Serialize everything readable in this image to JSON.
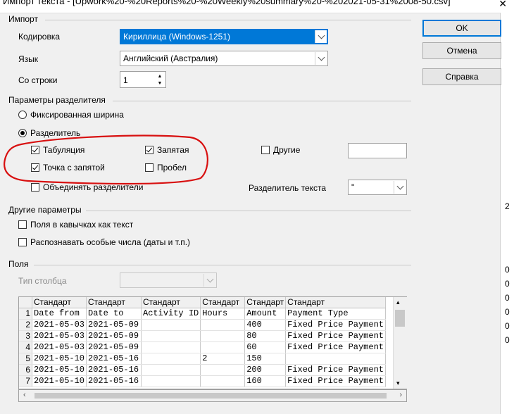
{
  "window": {
    "title": "Импорт текста - [Upwork%20-%20Reports%20-%20Weekly%20summary%20-%202021-05-31%2008-50.csv]"
  },
  "import": {
    "section": "Импорт",
    "encoding_label": "Кодировка",
    "encoding_value": "Кириллица (Windows-1251)",
    "language_label": "Язык",
    "language_value": "Английский (Австралия)",
    "from_row_label": "Со строки",
    "from_row_value": "1"
  },
  "buttons": {
    "ok": "OK",
    "cancel": "Отмена",
    "help": "Справка"
  },
  "separator": {
    "section": "Параметры разделителя",
    "fixed_width": "Фиксированная ширина",
    "separated_by": "Разделитель",
    "tab": "Табуляция",
    "comma": "Запятая",
    "other": "Другие",
    "semicolon": "Точка с запятой",
    "space": "Пробел",
    "merge": "Объединять разделители",
    "text_delim_label": "Разделитель текста",
    "text_delim_value": "\""
  },
  "other_options": {
    "section": "Другие параметры",
    "quoted_as_text": "Поля в кавычках как текст",
    "detect_special": "Распознавать особые числа (даты и т.п.)"
  },
  "fields": {
    "section": "Поля",
    "column_type_label": "Тип столбца",
    "table": {
      "types": [
        "Стандарт",
        "Стандарт",
        "Стандарт",
        "Стандарт",
        "Стандарт",
        "Стандарт"
      ],
      "rows": [
        {
          "n": "1",
          "cells": [
            "Date from",
            "Date to",
            "Activity ID",
            "Hours",
            "Amount",
            "Payment Type"
          ]
        },
        {
          "n": "2",
          "cells": [
            "2021-05-03",
            "2021-05-09",
            "",
            "",
            "400",
            "Fixed Price Payment"
          ]
        },
        {
          "n": "3",
          "cells": [
            "2021-05-03",
            "2021-05-09",
            "",
            "",
            "80",
            "Fixed Price Payment"
          ]
        },
        {
          "n": "4",
          "cells": [
            "2021-05-03",
            "2021-05-09",
            "",
            "",
            "60",
            "Fixed Price Payment"
          ]
        },
        {
          "n": "5",
          "cells": [
            "2021-05-10",
            "2021-05-16",
            "",
            "2",
            "150",
            ""
          ]
        },
        {
          "n": "6",
          "cells": [
            "2021-05-10",
            "2021-05-16",
            "",
            "",
            "200",
            "Fixed Price Payment"
          ]
        },
        {
          "n": "7",
          "cells": [
            "2021-05-10",
            "2021-05-16",
            "",
            "",
            "160",
            "Fixed Price Payment"
          ]
        }
      ]
    }
  },
  "right_edge": {
    "chars": [
      "2",
      "0",
      "0",
      "0",
      "0",
      "0",
      "0"
    ]
  }
}
